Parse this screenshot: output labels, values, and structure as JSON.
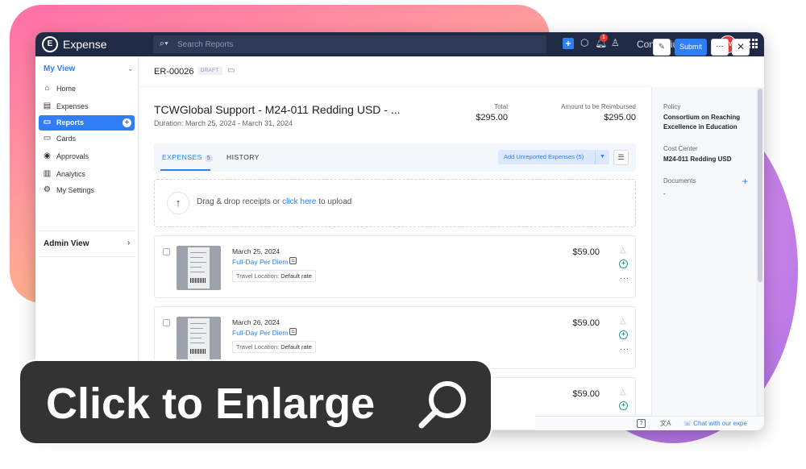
{
  "app": {
    "name": "Expense",
    "logo_letters": "E"
  },
  "search": {
    "placeholder": "Search Reports",
    "icon": "search-icon"
  },
  "topbar": {
    "notifications_count": "1",
    "org_name": "Consortium on...",
    "avatar_text": "TCW",
    "accent": "#2f7ef6",
    "bg": "#1f2a44"
  },
  "sidebar": {
    "my_view": "My View",
    "items": [
      {
        "label": "Home",
        "icon": "home-icon"
      },
      {
        "label": "Expenses",
        "icon": "receipt-icon"
      },
      {
        "label": "Reports",
        "icon": "folder-icon",
        "active": true
      },
      {
        "label": "Cards",
        "icon": "card-icon"
      },
      {
        "label": "Approvals",
        "icon": "check-circle-icon"
      },
      {
        "label": "Analytics",
        "icon": "chart-icon"
      },
      {
        "label": "My Settings",
        "icon": "gear-icon"
      }
    ],
    "admin_view": "Admin View"
  },
  "report": {
    "id": "ER-00026",
    "status": "DRAFT",
    "title": "TCWGlobal Support - M24-011 Redding USD - ...",
    "duration": "Duration: March 25, 2024 - March 31, 2024",
    "total_label": "Total",
    "total_value": "$295.00",
    "reimburse_label": "Amount to be Reimbursed",
    "reimburse_value": "$295.00",
    "submit_label": "Submit",
    "more_label": "···",
    "close_label": "✕"
  },
  "tabs": [
    {
      "label": "EXPENSES",
      "count": "5",
      "active": true
    },
    {
      "label": "HISTORY",
      "active": false
    }
  ],
  "add_unreported": "Add Unreported Expenses (5)",
  "dropzone": {
    "prefix": "Drag & drop receipts or ",
    "link": "click here",
    "suffix": " to upload"
  },
  "expenses": [
    {
      "date": "March 25, 2024",
      "category": "Full-Day Per Diem",
      "tag_key": "Travel Location:",
      "tag_value": "Default rate",
      "amount": "$59.00"
    },
    {
      "date": "March 26, 2024",
      "category": "Full-Day Per Diem",
      "tag_key": "Travel Location:",
      "tag_value": "Default rate",
      "amount": "$59.00"
    },
    {
      "date": "",
      "category": "",
      "tag_key": "",
      "tag_value": "",
      "amount": "$59.00"
    }
  ],
  "details": {
    "policy_label": "Policy",
    "policy_value": "Consortium on Reaching Excellence in Education",
    "cost_center_label": "Cost Center",
    "cost_center_value": "M24-011 Redding USD",
    "documents_label": "Documents",
    "documents_value": "-"
  },
  "bottombar": {
    "help": "?",
    "chat": "Chat with our expe"
  },
  "cta": {
    "label": "Click to Enlarge",
    "icon": "magnifier-icon"
  }
}
